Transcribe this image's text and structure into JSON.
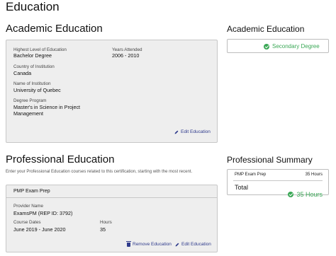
{
  "page": {
    "title": "Education"
  },
  "academic": {
    "title": "Academic Education",
    "highest_level_label": "Highest Level of Education",
    "highest_level_value": "Bachelor Degree",
    "years_label": "Years Attended",
    "years_value": "2006 - 2010",
    "country_label": "Country of Institution",
    "country_value": "Canada",
    "institution_label": "Name of Institution",
    "institution_value": "University of Quebec",
    "program_label": "Degree Program",
    "program_value_line1": "Master's in Science in Project",
    "program_value_line2": "Management",
    "edit_label": "Edit Education"
  },
  "academic_side": {
    "title": "Academic Education",
    "badge_label": "Secondary Degree",
    "badge_icon": "check-circle-icon",
    "badge_color": "#3aa856"
  },
  "professional": {
    "title": "Professional Education",
    "intro": "Enter your Professional Education courses related to this certification, starting with the most recent.",
    "course": {
      "name": "PMP Exam Prep",
      "provider_label": "Provider Name",
      "provider_value": "ExamsPM (REP ID: 3792)",
      "dates_label": "Course Dates",
      "dates_value": "June 2019 - June 2020",
      "hours_label": "Hours",
      "hours_value": "35",
      "remove_label": "Remove Education",
      "edit_label": "Edit Education"
    }
  },
  "summary": {
    "title": "Professional Summary",
    "row_name": "PMP Exam Prep",
    "row_hours": "35 Hours",
    "total_label": "Total",
    "total_value": "35 Hours",
    "total_icon": "check-circle-icon"
  },
  "colors": {
    "accent": "#2f3b8c",
    "success": "#3aa856",
    "card_bg": "#eeeeee"
  }
}
